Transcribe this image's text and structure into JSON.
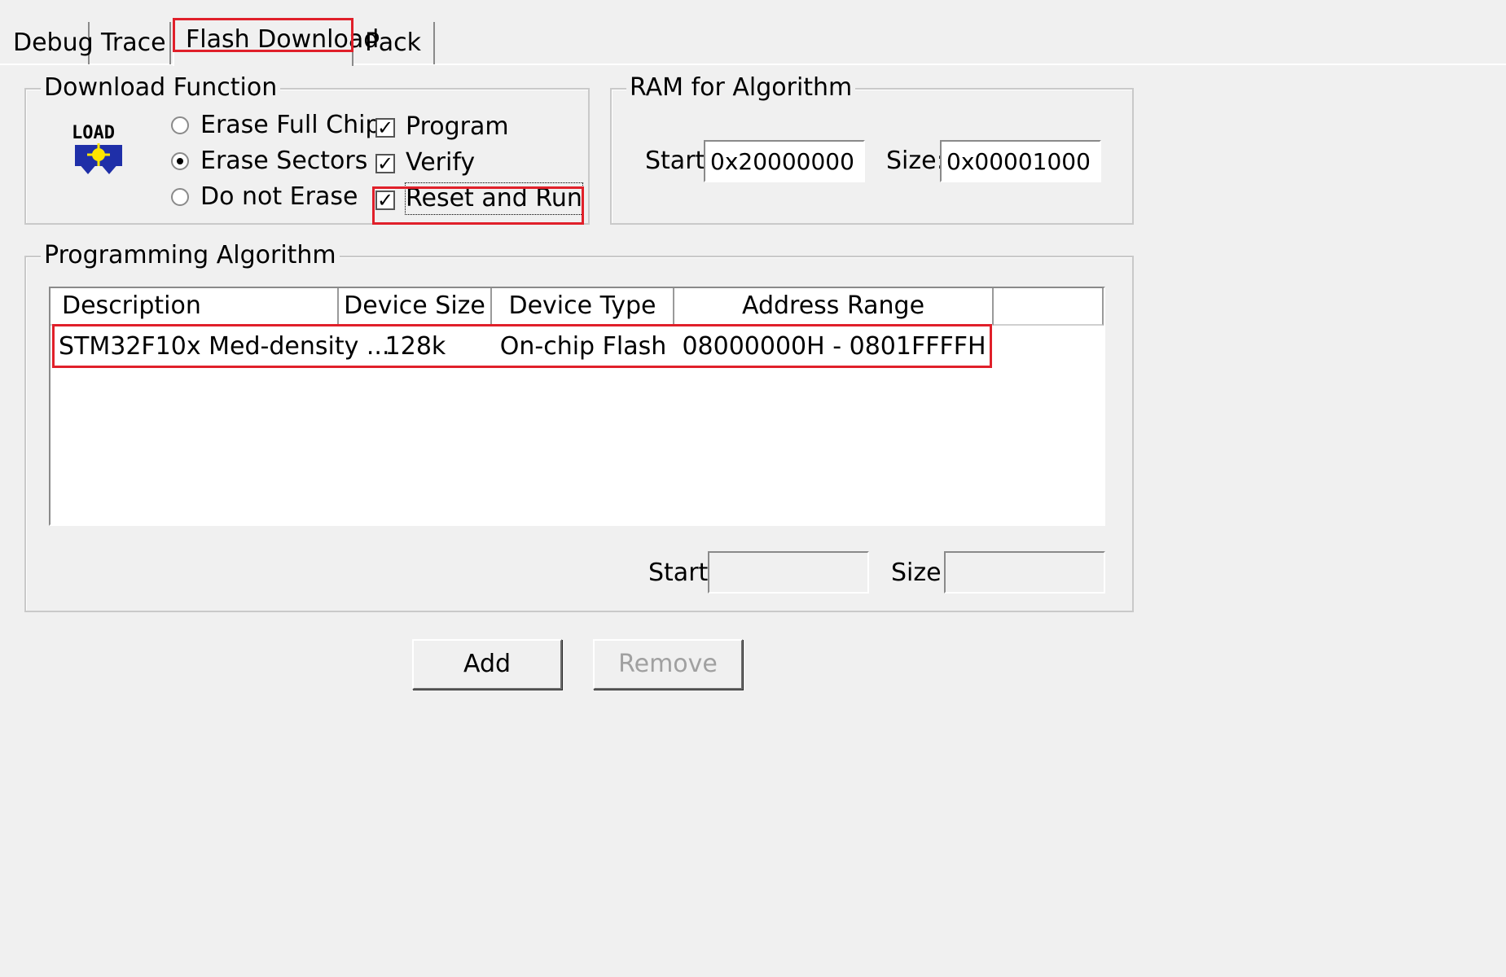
{
  "tabs": [
    {
      "label": "Debug"
    },
    {
      "label": "Trace"
    },
    {
      "label": "Flash Download"
    },
    {
      "label": "Pack"
    }
  ],
  "active_tab": "Flash Download",
  "download_function": {
    "title": "Download Function",
    "icon": "load-icon",
    "erase_options": [
      {
        "label": "Erase Full Chip",
        "selected": false
      },
      {
        "label": "Erase Sectors",
        "selected": true
      },
      {
        "label": "Do not Erase",
        "selected": false
      }
    ],
    "actions": [
      {
        "label": "Program",
        "checked": true
      },
      {
        "label": "Verify",
        "checked": true
      },
      {
        "label": "Reset and Run",
        "checked": true
      }
    ]
  },
  "ram_for_algorithm": {
    "title": "RAM for Algorithm",
    "start_label": "Start:",
    "start_value": "0x20000000",
    "size_label": "Size:",
    "size_value": "0x00001000"
  },
  "programming_algorithm": {
    "title": "Programming Algorithm",
    "columns": [
      "Description",
      "Device Size",
      "Device Type",
      "Address Range"
    ],
    "rows": [
      {
        "description": "STM32F10x Med-density ...",
        "device_size": "128k",
        "device_type": "On-chip Flash",
        "address_range": "08000000H - 0801FFFFH"
      }
    ],
    "start_label": "Start:",
    "start_value": "",
    "size_label": "Size:",
    "size_value": ""
  },
  "buttons": {
    "add": "Add",
    "remove": "Remove"
  },
  "highlight_color": "#e0202a"
}
